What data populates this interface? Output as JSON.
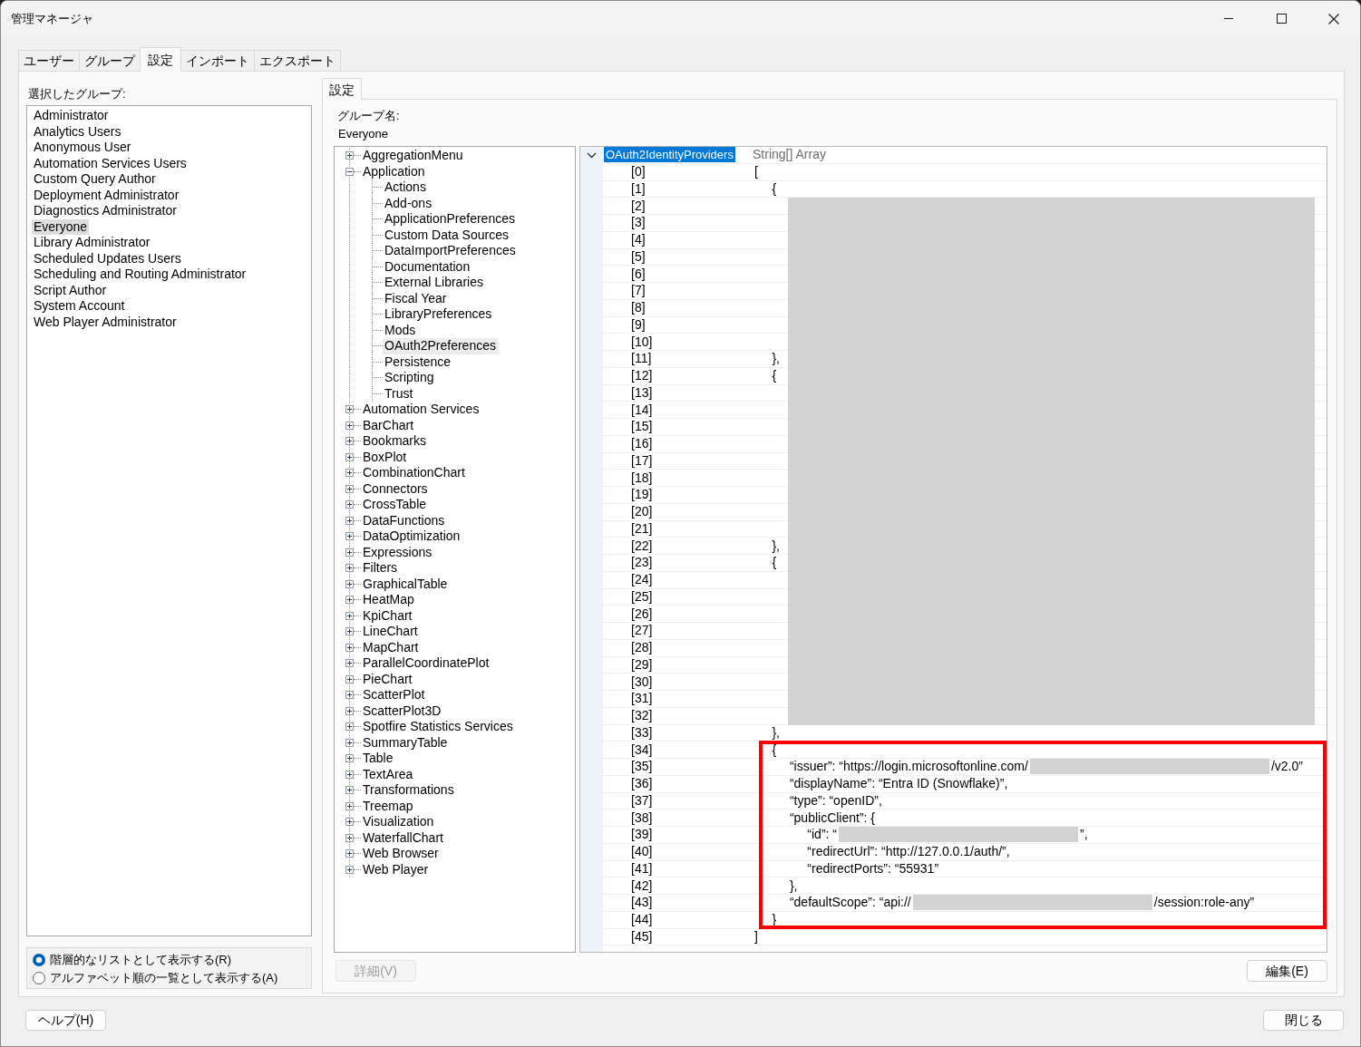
{
  "window": {
    "title": "管理マネージャ"
  },
  "tabs": [
    {
      "label": "ユーザー",
      "selected": false
    },
    {
      "label": "グループ",
      "selected": false
    },
    {
      "label": "設定",
      "selected": true
    },
    {
      "label": "インポート",
      "selected": false
    },
    {
      "label": "エクスポート",
      "selected": false
    }
  ],
  "groups": {
    "label": "選択したグループ:",
    "items": [
      {
        "label": "Administrator",
        "selected": false
      },
      {
        "label": "Analytics Users",
        "selected": false
      },
      {
        "label": "Anonymous User",
        "selected": false
      },
      {
        "label": "Automation Services Users",
        "selected": false
      },
      {
        "label": "Custom Query Author",
        "selected": false
      },
      {
        "label": "Deployment Administrator",
        "selected": false
      },
      {
        "label": "Diagnostics Administrator",
        "selected": false
      },
      {
        "label": "Everyone",
        "selected": true
      },
      {
        "label": "Library Administrator",
        "selected": false
      },
      {
        "label": "Scheduled Updates Users",
        "selected": false
      },
      {
        "label": "Scheduling and Routing Administrator",
        "selected": false
      },
      {
        "label": "Script Author",
        "selected": false
      },
      {
        "label": "System Account",
        "selected": false
      },
      {
        "label": "Web Player Administrator",
        "selected": false
      }
    ]
  },
  "view_mode": [
    {
      "label": "階層的なリストとして表示する(R)",
      "selected": true
    },
    {
      "label": "アルファベット順の一覧として表示する(A)",
      "selected": false
    }
  ],
  "settings": {
    "tabs": [
      {
        "label": "設定",
        "selected": true
      }
    ],
    "group_name_label": "グループ名:",
    "group_name": "Everyone",
    "tree": [
      {
        "label": "AggregationMenu",
        "expanded": false,
        "selected": false
      },
      {
        "label": "Application",
        "expanded": true,
        "selected": false,
        "children": [
          {
            "label": "Actions",
            "selected": false
          },
          {
            "label": "Add-ons",
            "selected": false
          },
          {
            "label": "ApplicationPreferences",
            "selected": false
          },
          {
            "label": "Custom Data Sources",
            "selected": false
          },
          {
            "label": "DataImportPreferences",
            "selected": false
          },
          {
            "label": "Documentation",
            "selected": false
          },
          {
            "label": "External Libraries",
            "selected": false
          },
          {
            "label": "Fiscal Year",
            "selected": false
          },
          {
            "label": "LibraryPreferences",
            "selected": false
          },
          {
            "label": "Mods",
            "selected": false
          },
          {
            "label": "OAuth2Preferences",
            "selected": true
          },
          {
            "label": "Persistence",
            "selected": false
          },
          {
            "label": "Scripting",
            "selected": false
          },
          {
            "label": "Trust",
            "selected": false
          }
        ]
      },
      {
        "label": "Automation Services",
        "expanded": false,
        "selected": false
      },
      {
        "label": "BarChart",
        "expanded": false,
        "selected": false
      },
      {
        "label": "Bookmarks",
        "expanded": false,
        "selected": false
      },
      {
        "label": "BoxPlot",
        "expanded": false,
        "selected": false
      },
      {
        "label": "CombinationChart",
        "expanded": false,
        "selected": false
      },
      {
        "label": "Connectors",
        "expanded": false,
        "selected": false
      },
      {
        "label": "CrossTable",
        "expanded": false,
        "selected": false
      },
      {
        "label": "DataFunctions",
        "expanded": false,
        "selected": false
      },
      {
        "label": "DataOptimization",
        "expanded": false,
        "selected": false
      },
      {
        "label": "Expressions",
        "expanded": false,
        "selected": false
      },
      {
        "label": "Filters",
        "expanded": false,
        "selected": false
      },
      {
        "label": "GraphicalTable",
        "expanded": false,
        "selected": false
      },
      {
        "label": "HeatMap",
        "expanded": false,
        "selected": false
      },
      {
        "label": "KpiChart",
        "expanded": false,
        "selected": false
      },
      {
        "label": "LineChart",
        "expanded": false,
        "selected": false
      },
      {
        "label": "MapChart",
        "expanded": false,
        "selected": false
      },
      {
        "label": "ParallelCoordinatePlot",
        "expanded": false,
        "selected": false
      },
      {
        "label": "PieChart",
        "expanded": false,
        "selected": false
      },
      {
        "label": "ScatterPlot",
        "expanded": false,
        "selected": false
      },
      {
        "label": "ScatterPlot3D",
        "expanded": false,
        "selected": false
      },
      {
        "label": "Spotfire Statistics Services",
        "expanded": false,
        "selected": false
      },
      {
        "label": "SummaryTable",
        "expanded": false,
        "selected": false
      },
      {
        "label": "Table",
        "expanded": false,
        "selected": false
      },
      {
        "label": "TextArea",
        "expanded": false,
        "selected": false
      },
      {
        "label": "Transformations",
        "expanded": false,
        "selected": false
      },
      {
        "label": "Treemap",
        "expanded": false,
        "selected": false
      },
      {
        "label": "Visualization",
        "expanded": false,
        "selected": false
      },
      {
        "label": "WaterfallChart",
        "expanded": false,
        "selected": false
      },
      {
        "label": "Web Browser",
        "expanded": false,
        "selected": false
      },
      {
        "label": "Web Player",
        "expanded": false,
        "selected": false
      }
    ],
    "property_grid": {
      "property": {
        "name": "OAuth2IdentityProviders",
        "type": "String[] Array",
        "expanded": true,
        "selected": true
      },
      "rows": [
        {
          "kind": "row",
          "index": "[0]",
          "value": "["
        },
        {
          "kind": "row",
          "index": "[1]",
          "value": "     {"
        },
        {
          "kind": "redacted",
          "rows": [
            {
              "index": "[2]"
            },
            {
              "index": "[3]"
            },
            {
              "index": "[4]"
            },
            {
              "index": "[5]"
            },
            {
              "index": "[6]"
            },
            {
              "index": "[7]"
            },
            {
              "index": "[8]"
            },
            {
              "index": "[9]"
            },
            {
              "index": "[10]"
            },
            {
              "index": "[11]",
              "value": "     },"
            },
            {
              "index": "[12]",
              "value": "     {"
            },
            {
              "index": "[13]"
            },
            {
              "index": "[14]"
            },
            {
              "index": "[15]"
            },
            {
              "index": "[16]"
            },
            {
              "index": "[17]"
            },
            {
              "index": "[18]"
            },
            {
              "index": "[19]"
            },
            {
              "index": "[20]"
            },
            {
              "index": "[21]"
            },
            {
              "index": "[22]",
              "value": "     },"
            },
            {
              "index": "[23]",
              "value": "     {"
            },
            {
              "index": "[24]"
            },
            {
              "index": "[25]"
            },
            {
              "index": "[26]"
            },
            {
              "index": "[27]"
            },
            {
              "index": "[28]"
            },
            {
              "index": "[29]"
            },
            {
              "index": "[30]"
            },
            {
              "index": "[31]"
            },
            {
              "index": "[32]"
            }
          ]
        },
        {
          "kind": "row",
          "index": "[33]",
          "value": "     },"
        },
        {
          "kind": "highlighted",
          "rows": [
            {
              "index": "[34]",
              "value": "     {"
            },
            {
              "index": "[35]",
              "parts": [
                {
                  "kind": "text",
                  "text": "          “issuer”: “https://login.microsoftonline.com/"
                },
                {
                  "kind": "redacted"
                },
                {
                  "kind": "text",
                  "text": "/v2.0”"
                }
              ]
            },
            {
              "index": "[36]",
              "value": "          “displayName”: “Entra ID (Snowflake)”,"
            },
            {
              "index": "[37]",
              "value": "          “type”: “openID”,"
            },
            {
              "index": "[38]",
              "value": "          “publicClient”: {"
            },
            {
              "index": "[39]",
              "parts": [
                {
                  "kind": "text",
                  "text": "               “id”: “"
                },
                {
                  "kind": "redacted"
                },
                {
                  "kind": "text",
                  "text": "”,"
                }
              ]
            },
            {
              "index": "[40]",
              "value": "               “redirectUrl”: “http://127.0.0.1/auth/”,"
            },
            {
              "index": "[41]",
              "value": "               “redirectPorts”: “55931”"
            },
            {
              "index": "[42]",
              "value": "          },"
            },
            {
              "index": "[43]",
              "parts": [
                {
                  "kind": "text",
                  "text": "          “defaultScope”: “api://"
                },
                {
                  "kind": "redacted"
                },
                {
                  "kind": "text",
                  "text": "/session:role-any”"
                }
              ]
            },
            {
              "index": "[44]",
              "value": "     }"
            }
          ]
        },
        {
          "kind": "row",
          "index": "[45]",
          "value": "]"
        }
      ]
    },
    "details_button": {
      "label": "詳細(V)",
      "disabled": true
    },
    "edit_button": {
      "label": "編集(E)",
      "disabled": false
    }
  },
  "help_button": {
    "label": "ヘルプ(H)"
  },
  "close_button": {
    "label": "閉じる"
  }
}
